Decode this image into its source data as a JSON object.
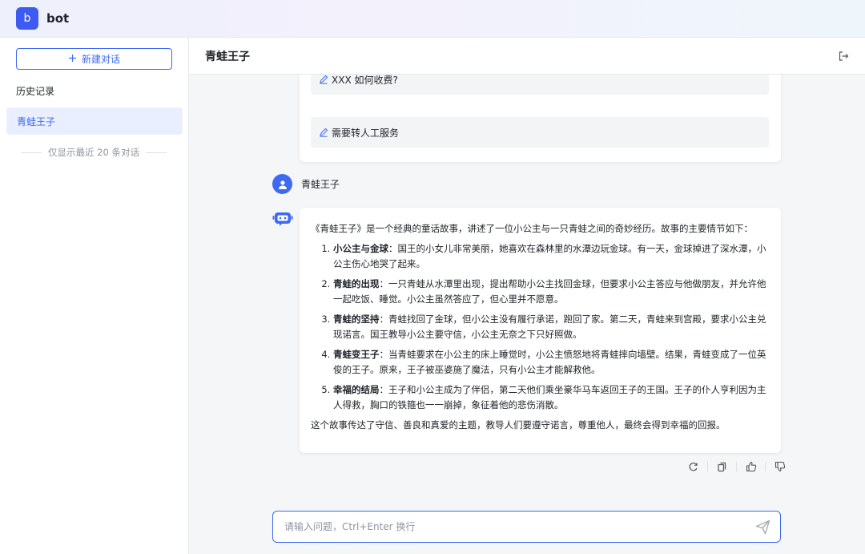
{
  "app": {
    "logo_letter": "b",
    "name": "bot"
  },
  "sidebar": {
    "new_chat_label": "新建对话",
    "history_title": "历史记录",
    "history_items": [
      {
        "label": "青蛙王子"
      }
    ],
    "history_note": "仅显示最近 20 条对话"
  },
  "chat": {
    "title": "青蛙王子",
    "suggestions": [
      {
        "label": "XXX 如何收费?"
      },
      {
        "label": "需要转人工服务"
      }
    ],
    "user_message": {
      "name": "青蛙王子"
    },
    "answer": {
      "intro": "《青蛙王子》是一个经典的童话故事，讲述了一位小公主与一只青蛙之间的奇妙经历。故事的主要情节如下：",
      "items": [
        {
          "heading": "小公主与金球",
          "text": "：国王的小女儿非常美丽，她喜欢在森林里的水潭边玩金球。有一天，金球掉进了深水潭，小公主伤心地哭了起来。"
        },
        {
          "heading": "青蛙的出现",
          "text": "：一只青蛙从水潭里出现，提出帮助小公主找回金球，但要求小公主答应与他做朋友，并允许他一起吃饭、睡觉。小公主虽然答应了，但心里并不愿意。"
        },
        {
          "heading": "青蛙的坚持",
          "text": "：青蛙找回了金球，但小公主没有履行承诺，跑回了家。第二天，青蛙来到宫殿，要求小公主兑现诺言。国王教导小公主要守信，小公主无奈之下只好照做。"
        },
        {
          "heading": "青蛙变王子",
          "text": "：当青蛙要求在小公主的床上睡觉时，小公主愤怒地将青蛙摔向墙壁。结果，青蛙变成了一位英俊的王子。原来，王子被巫婆施了魔法，只有小公主才能解救他。"
        },
        {
          "heading": "幸福的结局",
          "text": "：王子和小公主成为了伴侣，第二天他们乘坐豪华马车返回王子的王国。王子的仆人亨利因为主人得救，胸口的铁箍也一一崩掉，象征着他的悲伤消散。"
        }
      ],
      "conclusion": "这个故事传达了守信、善良和真爱的主题，教导人们要遵守诺言，尊重他人，最终会得到幸福的回报。"
    },
    "actions": [
      "refresh-icon",
      "copy-icon",
      "thumbs-up-icon",
      "thumbs-down-icon"
    ],
    "input": {
      "placeholder": "请输入问题，Ctrl+Enter 换行",
      "value": ""
    }
  },
  "colors": {
    "accent": "#3d6af1",
    "selected_bg": "#e9effe",
    "main_bg": "#f5f6f8"
  }
}
